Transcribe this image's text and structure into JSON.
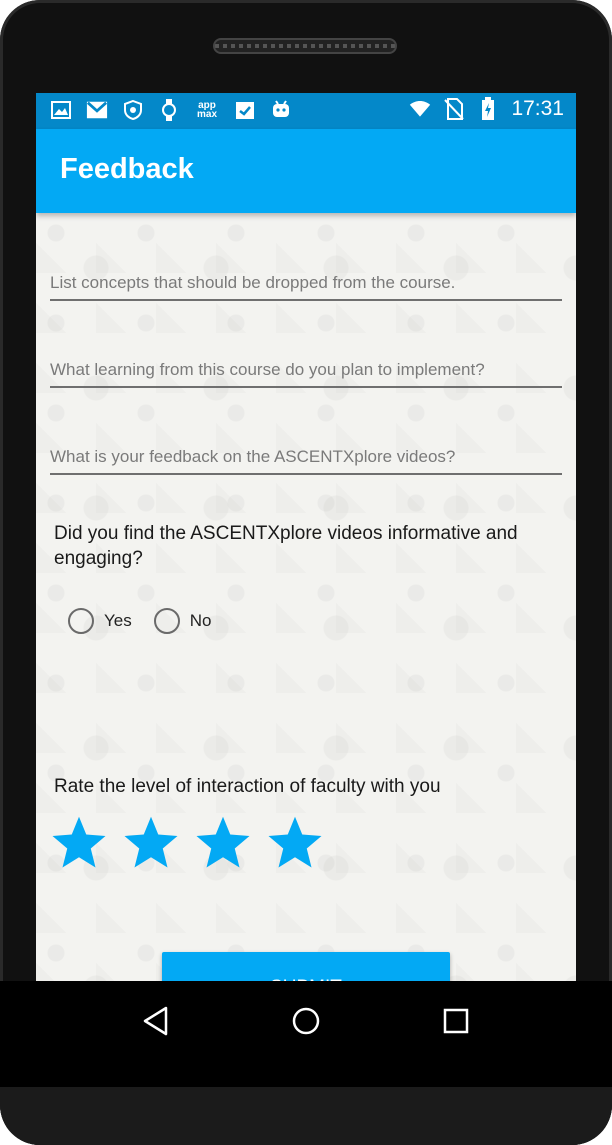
{
  "statusbar": {
    "time": "17:31",
    "app_icon_text": "app\nmax",
    "left_icons": [
      "image-icon",
      "gmail-icon",
      "shield-icon",
      "watch-icon",
      "appmax-icon",
      "clipboard-check-icon",
      "android-icon"
    ],
    "right_icons": [
      "wifi-icon",
      "no-sim-icon",
      "battery-charging-icon"
    ]
  },
  "appbar": {
    "title": "Feedback"
  },
  "form": {
    "fields": [
      {
        "placeholder": "List concepts that should be dropped from the course.",
        "value": ""
      },
      {
        "placeholder": "What learning from this course do you plan to implement?",
        "value": ""
      },
      {
        "placeholder": "What is your feedback on the ASCENTXplore videos?",
        "value": ""
      }
    ],
    "question_videos": "Did you find the ASCENTXplore videos informative and engaging?",
    "radio_options": [
      "Yes",
      "No"
    ],
    "question_rating": "Rate the level of interaction of faculty with you",
    "rating": {
      "filled": 4,
      "max": 4
    },
    "submit_label": "SUBMIT"
  },
  "colors": {
    "statusbar": "#0488c9",
    "appbar": "#03a9f4",
    "accent": "#03a9f4",
    "background": "#f3f3f0"
  },
  "navbar": {
    "icons": [
      "back-icon",
      "home-icon",
      "recents-icon"
    ]
  }
}
